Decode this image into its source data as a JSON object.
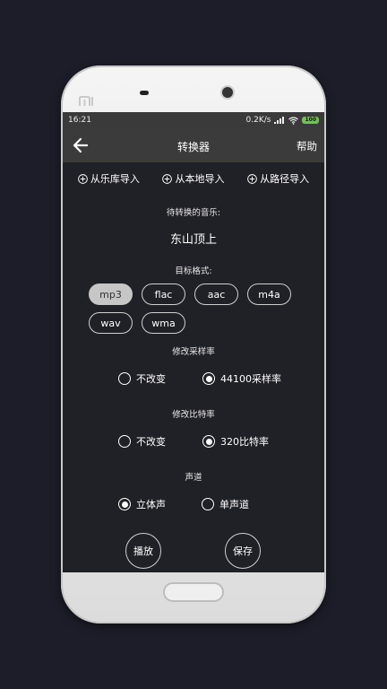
{
  "statusbar": {
    "time": "16:21",
    "speed": "0.2K/s",
    "battery": "100"
  },
  "appbar": {
    "title": "转换器",
    "help": "帮助"
  },
  "imports": [
    {
      "label": "从乐库导入"
    },
    {
      "label": "从本地导入"
    },
    {
      "label": "从路径导入"
    }
  ],
  "pending": {
    "label": "待转换的音乐:",
    "song": "东山顶上"
  },
  "target": {
    "label": "目标格式:",
    "formats": [
      "mp3",
      "flac",
      "aac",
      "m4a",
      "wav",
      "wma"
    ],
    "selected": "mp3"
  },
  "sample_rate": {
    "label": "修改采样率",
    "options": [
      "不改变",
      "44100采样率"
    ],
    "selected": "44100采样率"
  },
  "bit_rate": {
    "label": "修改比特率",
    "options": [
      "不改变",
      "320比特率"
    ],
    "selected": "320比特率"
  },
  "channel": {
    "label": "声道",
    "options": [
      "立体声",
      "单声道"
    ],
    "selected": "立体声"
  },
  "actions": {
    "play": "播放",
    "save": "保存"
  }
}
